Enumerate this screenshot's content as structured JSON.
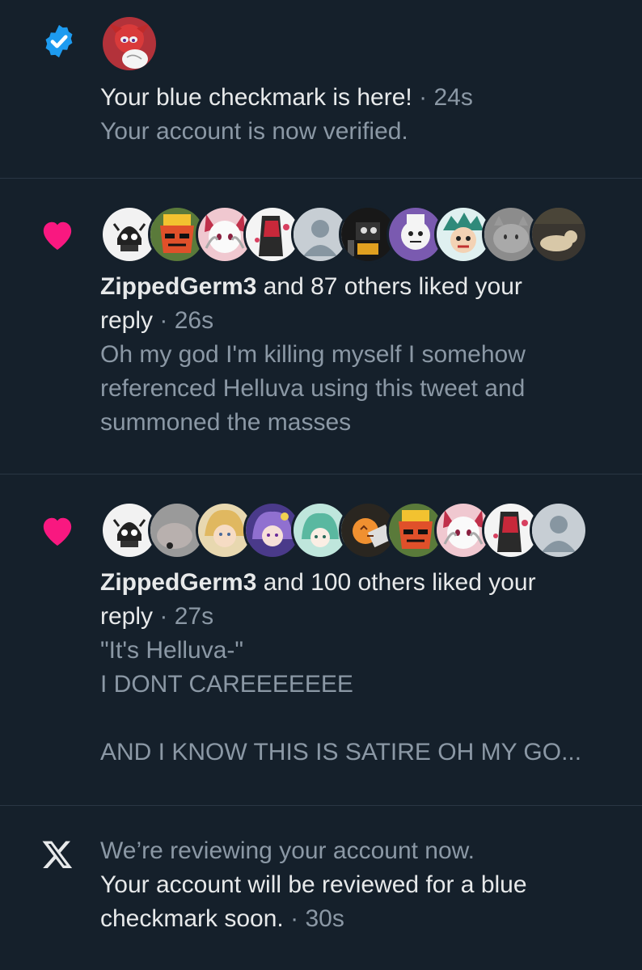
{
  "notifications": [
    {
      "type": "verified",
      "icon": "verified-badge-icon",
      "title": "Your blue checkmark is here!",
      "separator": "·",
      "time": "24s",
      "body": "Your account is now verified."
    },
    {
      "type": "like",
      "icon": "heart-icon",
      "user": "ZippedGerm3",
      "action": " and 87 others liked your",
      "action2": "reply",
      "separator": "·",
      "time": "26s",
      "body_lines": [
        "Oh my god I'm killing myself I somehow",
        "referenced Helluva using this tweet and",
        "summoned the masses"
      ],
      "avatar_count": 11
    },
    {
      "type": "like",
      "icon": "heart-icon",
      "user": "ZippedGerm3",
      "action": " and 100 others liked your",
      "action2": "reply",
      "separator": "·",
      "time": "27s",
      "body_lines": [
        "\"It's Helluva-\"",
        "I DONT CAREEEEEEE",
        "",
        "AND I KNOW THIS IS SATIRE OH MY GO..."
      ],
      "avatar_count": 11
    },
    {
      "type": "system",
      "icon": "x-logo-icon",
      "title": "We’re reviewing your account now.",
      "body_line1": "Your account will be reviewed for a blue",
      "body_line2": "checkmark soon.",
      "separator": "·",
      "time": "30s"
    }
  ],
  "colors": {
    "background": "#15202b",
    "heart": "#f91880",
    "verified": "#1d9bf0",
    "muted_text": "#8b98a5",
    "primary_text": "#e7e9ea"
  }
}
